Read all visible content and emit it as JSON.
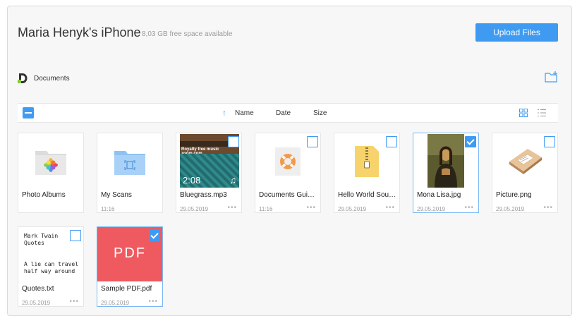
{
  "device": {
    "name": "Maria Henyk's iPhone",
    "free_space": "8,03 GB free space available"
  },
  "actions": {
    "upload_label": "Upload Files"
  },
  "breadcrumb": {
    "current": "Documents"
  },
  "toolbar": {
    "columns": {
      "name": "Name",
      "date": "Date",
      "size": "Size"
    },
    "sort": "Name ascending"
  },
  "colors": {
    "accent": "#3f9bf1",
    "pdf": "#ee5a5f"
  },
  "files": [
    {
      "name": "Photo Albums",
      "meta": "",
      "icon": "photos-folder-icon",
      "selected": false
    },
    {
      "name": "My Scans",
      "meta": "11:16",
      "icon": "scans-folder-icon",
      "selected": false
    },
    {
      "name": "Bluegrass.mp3",
      "meta": "29.05.2019",
      "icon": "audio-thumbnail",
      "selected": false,
      "thumb_banner": "Royalty free music zoom.com",
      "thumb_duration": "2:08"
    },
    {
      "name": "Documents Guid…",
      "meta": "11:16",
      "icon": "lifebuoy-icon",
      "selected": false
    },
    {
      "name": "Hello World Sour…",
      "meta": "29.05.2019",
      "icon": "zip-archive-icon",
      "selected": false
    },
    {
      "name": "Mona Lisa.jpg",
      "meta": "29.05.2019",
      "icon": "painting-thumbnail",
      "selected": true
    },
    {
      "name": "Picture.png",
      "meta": "29.05.2019",
      "icon": "parcel-thumbnail",
      "selected": false
    },
    {
      "name": "Quotes.txt",
      "meta": "29.05.2019",
      "icon": "text-preview",
      "selected": false,
      "preview_title": "Mark Twain Quotes",
      "preview_body": "A lie can travel half way around"
    },
    {
      "name": "Sample PDF.pdf",
      "meta": "29.05.2019",
      "icon": "pdf-thumbnail",
      "selected": true,
      "thumb_label": "PDF"
    }
  ]
}
